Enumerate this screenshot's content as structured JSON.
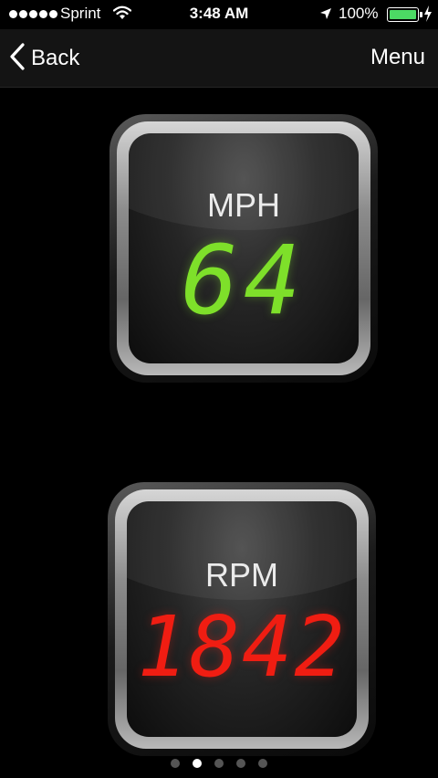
{
  "status_bar": {
    "signal_bars": 5,
    "carrier": "Sprint",
    "time": "3:48 AM",
    "battery_percent": "100%",
    "battery_level": 1.0,
    "icons": [
      "signal-dots-icon",
      "wifi-icon",
      "location-arrow-icon",
      "battery-icon",
      "charging-bolt-icon"
    ]
  },
  "nav": {
    "back_label": "Back",
    "menu_label": "Menu",
    "back_icon": "chevron-left-icon"
  },
  "gauges": {
    "speed": {
      "label": "MPH",
      "value": "64",
      "color": "#7ee02a"
    },
    "rpm": {
      "label": "RPM",
      "value": "1842",
      "color": "#f01d12"
    }
  },
  "pager": {
    "count": 5,
    "active_index": 1
  }
}
